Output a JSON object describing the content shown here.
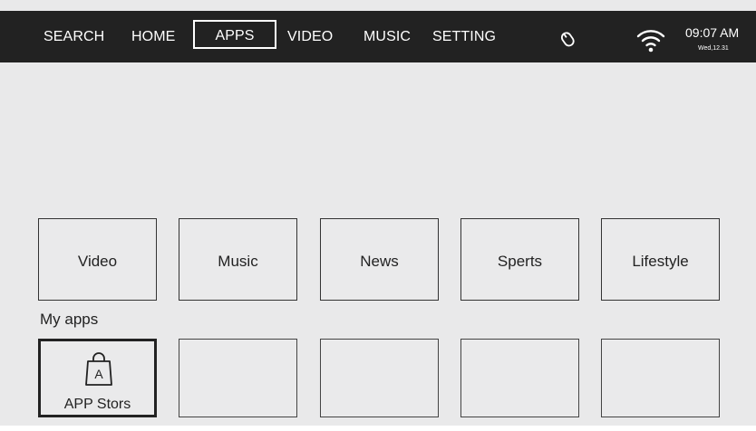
{
  "nav": {
    "items": [
      "SEARCH",
      "HOME",
      "APPS",
      "VIDEO",
      "MUSIC",
      "SETTING"
    ],
    "selected": "APPS"
  },
  "status": {
    "time": "09:07 AM",
    "date": "Wed,12.31",
    "icons": [
      "mouse-icon",
      "wifi-icon"
    ]
  },
  "categories": [
    "Video",
    "Music",
    "News",
    "Sperts",
    "Lifestyle"
  ],
  "my_apps": {
    "label": "My apps",
    "items": [
      {
        "label": "APP Stors",
        "icon": "shopping-bag-icon",
        "badge": "A",
        "selected": true
      },
      {
        "label": "",
        "selected": false
      },
      {
        "label": "",
        "selected": false
      },
      {
        "label": "",
        "selected": false
      },
      {
        "label": "",
        "selected": false
      }
    ]
  },
  "colors": {
    "topbar": "#222222",
    "background": "#e9e9ea",
    "text": "#222222",
    "border": "#333333"
  }
}
